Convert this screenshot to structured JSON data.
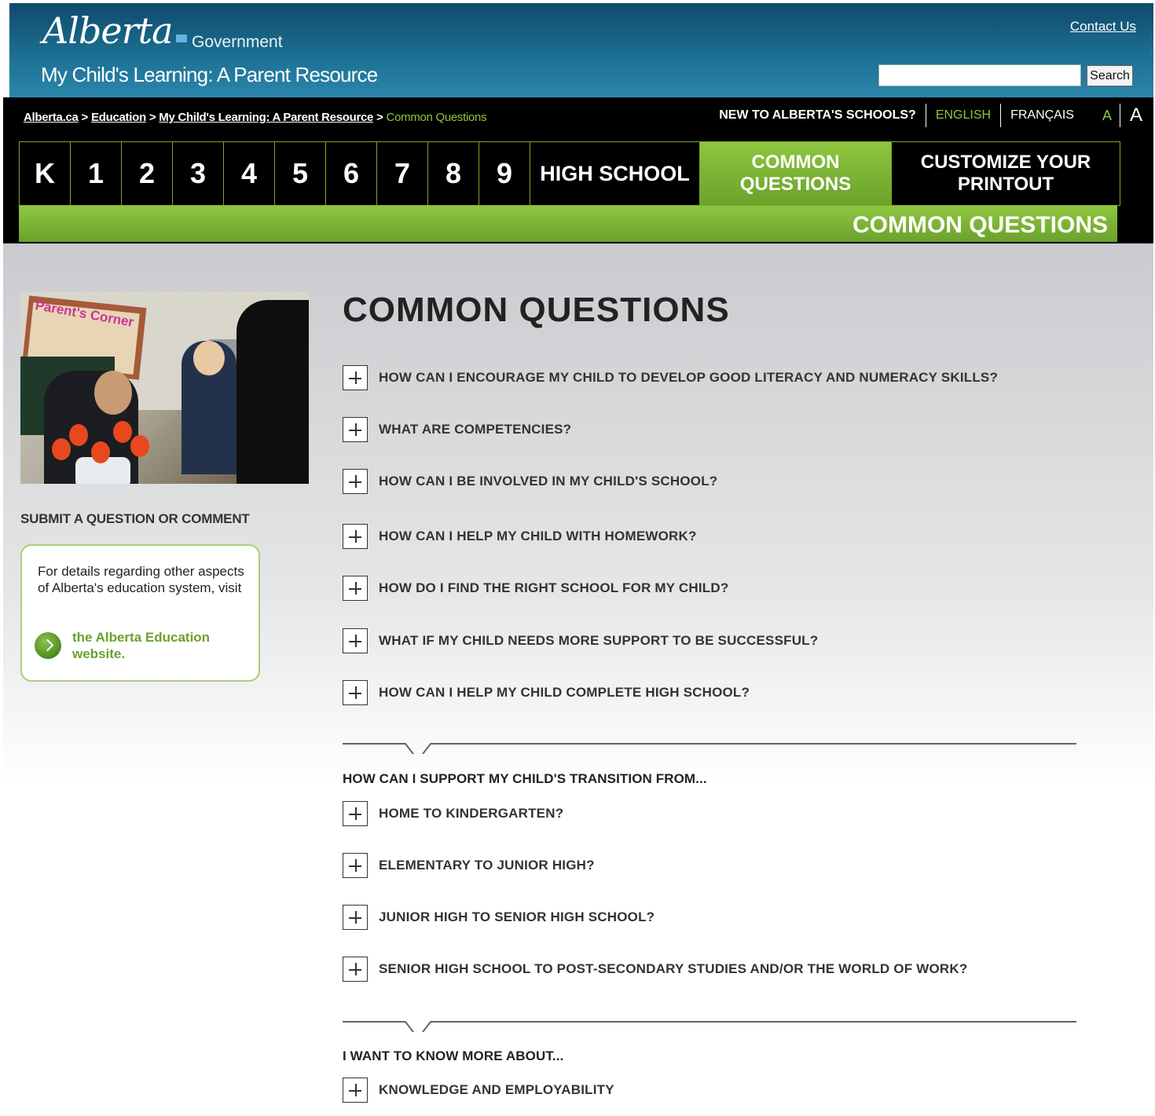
{
  "header": {
    "logo_text": "Alberta",
    "government": "Government",
    "site_title": "My Child's Learning: A Parent Resource",
    "contact": "Contact Us",
    "search_button": "Search",
    "search_value": ""
  },
  "breadcrumb": {
    "items": [
      "Alberta.ca",
      "Education",
      "My Child's Learning: A Parent Resource"
    ],
    "separator": ">",
    "current": "Common Questions"
  },
  "topbar": {
    "new_to": "NEW TO ALBERTA'S SCHOOLS?",
    "english": "ENGLISH",
    "french": "FRANÇAIS",
    "font_small": "A",
    "font_large": "A"
  },
  "nav": {
    "grades": [
      "K",
      "1",
      "2",
      "3",
      "4",
      "5",
      "6",
      "7",
      "8",
      "9"
    ],
    "high_school": "HIGH SCHOOL",
    "common_questions": "COMMON QUESTIONS",
    "customize": "CUSTOMIZE YOUR PRINTOUT",
    "active_label": "COMMON QUESTIONS"
  },
  "sidebar": {
    "photo_sign": "Parent's Corner",
    "submit_title": "SUBMIT A QUESTION OR COMMENT",
    "info_text": "For details regarding other aspects of Alberta's education system, visit",
    "link_text": "the Alberta Education website."
  },
  "main": {
    "title": "COMMON QUESTIONS",
    "questions": [
      "HOW CAN I ENCOURAGE MY CHILD TO DEVELOP GOOD LITERACY AND NUMERACY SKILLS?",
      "WHAT ARE COMPETENCIES?",
      "HOW CAN I BE INVOLVED IN MY CHILD'S SCHOOL?",
      "HOW CAN I HELP MY CHILD WITH HOMEWORK?",
      "HOW DO I FIND THE RIGHT SCHOOL FOR MY CHILD?",
      "WHAT IF MY CHILD NEEDS MORE SUPPORT TO BE SUCCESSFUL?",
      "HOW CAN I HELP MY CHILD COMPLETE HIGH SCHOOL?"
    ],
    "transition_head": "HOW CAN I SUPPORT MY CHILD'S TRANSITION FROM...",
    "transitions": [
      "HOME TO KINDERGARTEN?",
      "ELEMENTARY TO JUNIOR HIGH?",
      "JUNIOR HIGH TO SENIOR HIGH SCHOOL?",
      "SENIOR HIGH SCHOOL TO POST-SECONDARY STUDIES AND/OR THE WORLD OF WORK?"
    ],
    "more_head": "I WANT TO KNOW MORE ABOUT...",
    "more": [
      "KNOWLEDGE AND EMPLOYABILITY"
    ]
  },
  "colors": {
    "header_blue": "#1c6f92",
    "accent_green": "#8fc63f",
    "nav_black": "#000000"
  },
  "icons": {
    "expand": "plus-icon",
    "link_arrow": "chevron-right-icon",
    "section_divider": "chevron-down-icon"
  }
}
